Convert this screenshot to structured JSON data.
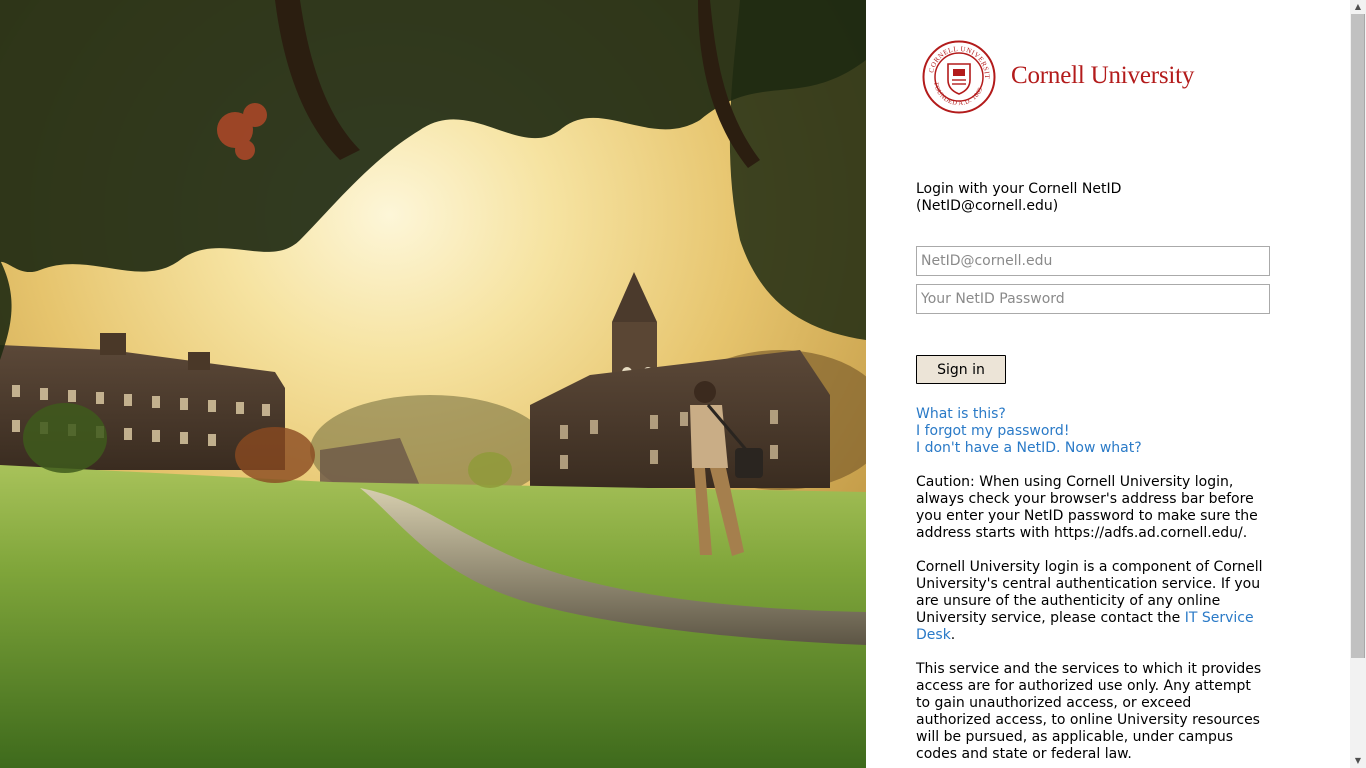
{
  "brand": {
    "university_name": "Cornell University",
    "seal_icon": "cornell-seal-icon",
    "seal_text": "CORNELL UNIVERSITY · FOUNDED A.D. 1865",
    "color": "#b31b1b"
  },
  "login": {
    "intro": "Login with your Cornell NetID (NetID@cornell.edu)",
    "username": {
      "placeholder": "NetID@cornell.edu",
      "value": ""
    },
    "password": {
      "placeholder": "Your NetID Password",
      "value": ""
    },
    "signin_label": "Sign in"
  },
  "help_links": {
    "what_is_this": "What is this?",
    "forgot_password": "I forgot my password!",
    "no_netid": "I don't have a NetID. Now what?"
  },
  "notices": {
    "caution": "Caution: When using Cornell University login, always check your browser's address bar before you enter your NetID password to make sure the address starts with https://adfs.ad.cornell.edu/.",
    "component_prefix": "Cornell University login is a component of Cornell University's central authentication service. If you are unsure of the authenticity of any online University service, please contact the ",
    "it_service_desk_link": "IT Service Desk",
    "component_suffix": ".",
    "authorized_use": "This service and the services to which it provides access are for authorized use only. Any attempt to gain unauthorized access, or exceed authorized access, to online University resources will be pursued, as applicable, under campus codes and state or federal law."
  },
  "colors": {
    "link": "#2a7ac7",
    "button_bg": "#ece4d7",
    "brand_red": "#b31b1b"
  },
  "scrollbar": {
    "up_icon": "scroll-up-arrow-icon",
    "down_icon": "scroll-down-arrow-icon"
  }
}
